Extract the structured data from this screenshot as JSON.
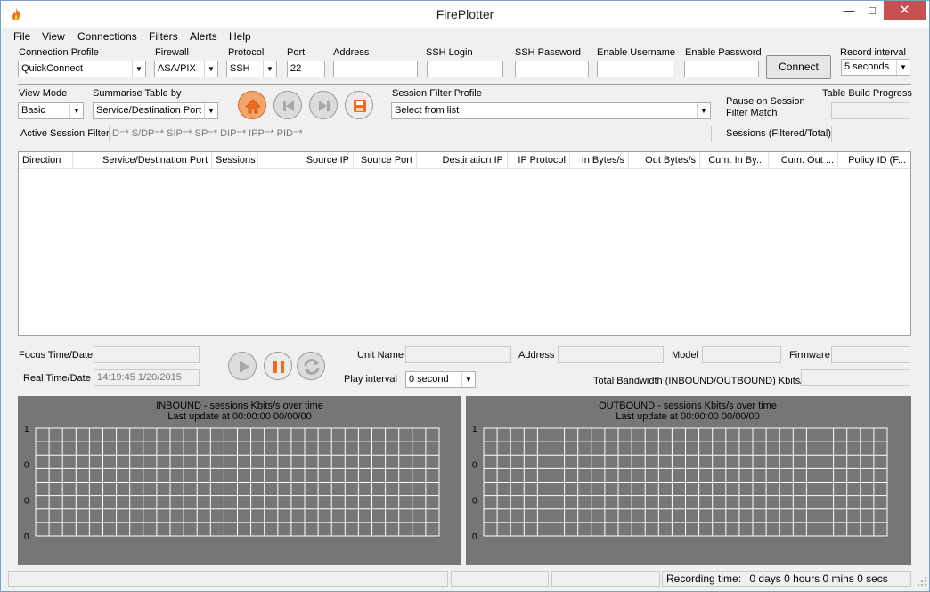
{
  "window": {
    "title": "FirePlotter"
  },
  "menu": [
    "File",
    "View",
    "Connections",
    "Filters",
    "Alerts",
    "Help"
  ],
  "connection": {
    "profile_label": "Connection Profile",
    "profile_value": "QuickConnect",
    "firewall_label": "Firewall",
    "firewall_value": "ASA/PIX",
    "protocol_label": "Protocol",
    "protocol_value": "SSH",
    "port_label": "Port",
    "port_value": "22",
    "address_label": "Address",
    "address_value": "",
    "ssh_login_label": "SSH Login",
    "ssh_login_value": "",
    "ssh_password_label": "SSH Password",
    "ssh_password_value": "",
    "enable_username_label": "Enable Username",
    "enable_username_value": "",
    "enable_password_label": "Enable Password",
    "enable_password_value": "",
    "connect_button": "Connect",
    "record_interval_label": "Record interval",
    "record_interval_value": "5 seconds"
  },
  "view": {
    "view_mode_label": "View Mode",
    "view_mode_value": "Basic",
    "summarise_label": "Summarise Table by",
    "summarise_value": "Service/Destination Port",
    "session_filter_profile_label": "Session Filter Profile",
    "session_filter_profile_value": "Select from list",
    "pause_label_1": "Pause on Session",
    "pause_label_2": "Filter Match",
    "table_build_progress_label": "Table Build Progress",
    "active_filter_label": "Active Session Filter",
    "active_filter_value": "D=* S/DP=* SIP=* SP=* DIP=* IPP=* PID=*",
    "sessions_filtered_label": "Sessions (Filtered/Total)"
  },
  "table": {
    "columns": [
      "Direction",
      "Service/Destination Port",
      "Sessions",
      "Source IP",
      "Source Port",
      "Destination IP",
      "IP Protocol",
      "In Bytes/s",
      "Out Bytes/s",
      "Cum. In By...",
      "Cum. Out ...",
      "Policy ID (F..."
    ]
  },
  "playback": {
    "focus_label": "Focus Time/Date",
    "focus_value": "",
    "real_label": "Real Time/Date",
    "real_value": "14:19:45  1/20/2015",
    "play_interval_label": "Play interval",
    "play_interval_value": "0 second"
  },
  "unit": {
    "unit_name_label": "Unit Name",
    "address_label": "Address",
    "model_label": "Model",
    "firmware_label": "Firmware",
    "total_bandwidth_label": "Total Bandwidth (INBOUND/OUTBOUND) Kbits/s"
  },
  "graphs": {
    "inbound": {
      "title": "INBOUND - sessions Kbits/s over time",
      "subtitle": "Last update at 00:00:00 00/00/00",
      "y_labels": [
        "1",
        "0",
        "0",
        "0"
      ]
    },
    "outbound": {
      "title": "OUTBOUND - sessions Kbits/s over time",
      "subtitle": "Last update at 00:00:00 00/00/00",
      "y_labels": [
        "1",
        "0",
        "0",
        "0"
      ]
    }
  },
  "status": {
    "recording_label": "Recording time:",
    "recording_value": "0 days  0 hours  0 mins  0 secs"
  },
  "colors": {
    "graph_bg": "#767676",
    "title_close": "#c75050",
    "home_orange": "#f07020"
  }
}
